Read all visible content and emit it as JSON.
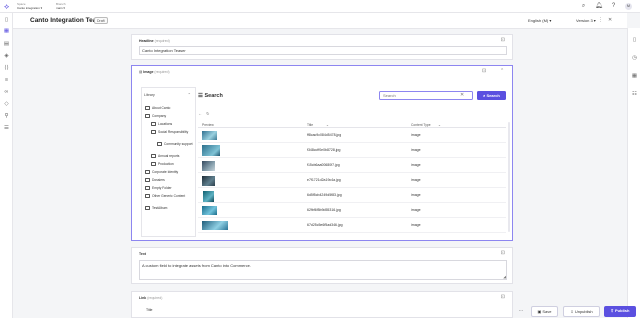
{
  "app": {
    "crumbs": [
      {
        "label": "Space",
        "value": "Canto integration ▾"
      },
      {
        "label": "Branch",
        "value": "main ▾"
      }
    ],
    "avatar": "M"
  },
  "header": {
    "title": "Canto Integration Teaser",
    "badge": "Draft",
    "locale": "English (M)  ▾",
    "version": "Version 3 ▾"
  },
  "headline": {
    "label": "Headline",
    "required": "(required)",
    "value": "Canto Integration Teaser"
  },
  "image_field": {
    "label": "Image",
    "required": "(required)",
    "library": {
      "title": "Library",
      "items": [
        {
          "label": "About Canto"
        },
        {
          "label": "Company"
        },
        {
          "label": "Locations"
        },
        {
          "label": "Social Responsibility"
        },
        {
          "label": "Community support"
        },
        {
          "label": "Annual reports"
        },
        {
          "label": "Production"
        },
        {
          "label": "Corporate Identity"
        },
        {
          "label": "Dossiers"
        },
        {
          "label": "Empty Folder"
        },
        {
          "label": "Other Generic Content"
        },
        {
          "label": "TestAlbum"
        }
      ]
    },
    "search": {
      "heading": "Search",
      "input_value": "Search",
      "button_label": "Search",
      "columns": [
        "Preview",
        "Title",
        "Content Type"
      ],
      "rows": [
        {
          "title": "ff8cac9c084d5478.jpg",
          "type": "image"
        },
        {
          "title": "f348ccff0e0b8728.jpg",
          "type": "image"
        },
        {
          "title": "f15cb6aa00680f7.jpg",
          "type": "image"
        },
        {
          "title": "e7f1721d2a19c4a.jpg",
          "type": "image"
        },
        {
          "title": "6d5f5cb4249d5f83.jpg",
          "type": "image"
        },
        {
          "title": "62fbf6f5b9d55316.jpg",
          "type": "image"
        },
        {
          "title": "67d25c5e6f5ad346.jpg",
          "type": "image"
        }
      ]
    }
  },
  "text_field": {
    "label": "Text",
    "value": "A custom field to integrate assets from Canto into Commerce.",
    "required": ""
  },
  "link_field": {
    "label": "Link",
    "required": "(required)",
    "sub_label": "Title"
  },
  "footer": {
    "more": "···",
    "save": "Save",
    "unpublish": "Unpublish",
    "publish": "Publish"
  },
  "colors": {
    "accent": "#5b50e0",
    "border": "#e2e2e8"
  }
}
